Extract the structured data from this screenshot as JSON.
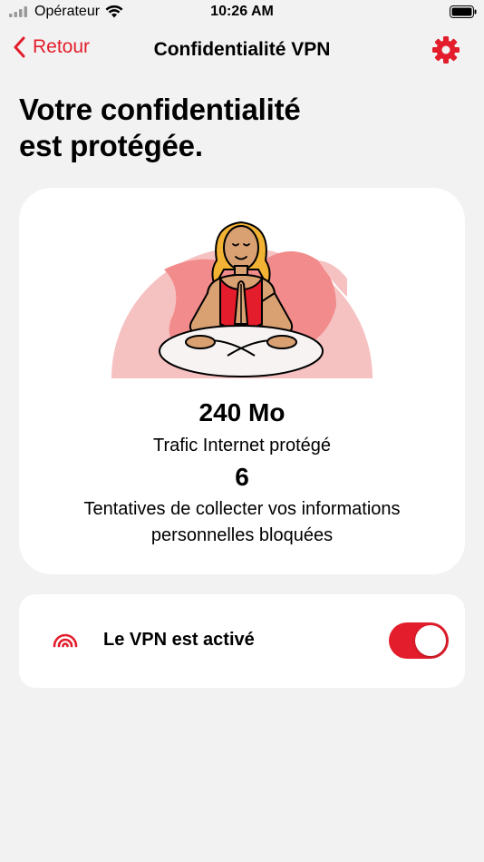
{
  "status_bar": {
    "carrier": "Opérateur",
    "time": "10:26 AM"
  },
  "nav": {
    "back_label": "Retour",
    "title": "Confidentialité VPN"
  },
  "headline": {
    "line1": "Votre confidentialité",
    "line2": "est protégée."
  },
  "stats": {
    "traffic_value": "240 Mo",
    "traffic_label": "Trafic Internet protégé",
    "attempts_value": "6",
    "attempts_label": "Tentatives de collecter vos informations personnelles bloquées"
  },
  "vpn": {
    "label": "Le VPN est activé",
    "enabled": true
  },
  "colors": {
    "accent": "#e31d2b",
    "background": "#f2f2f2",
    "card": "#ffffff",
    "illustration_pink": "#f6c1c1",
    "illustration_coral": "#f28b8b",
    "skin": "#d9a072",
    "hair": "#f2b233"
  },
  "icons": {
    "back": "chevron-left-icon",
    "settings": "gear-icon",
    "vpn": "vpn-signal-icon",
    "wifi": "wifi-icon",
    "signal": "cellular-signal-icon",
    "battery": "battery-icon"
  }
}
